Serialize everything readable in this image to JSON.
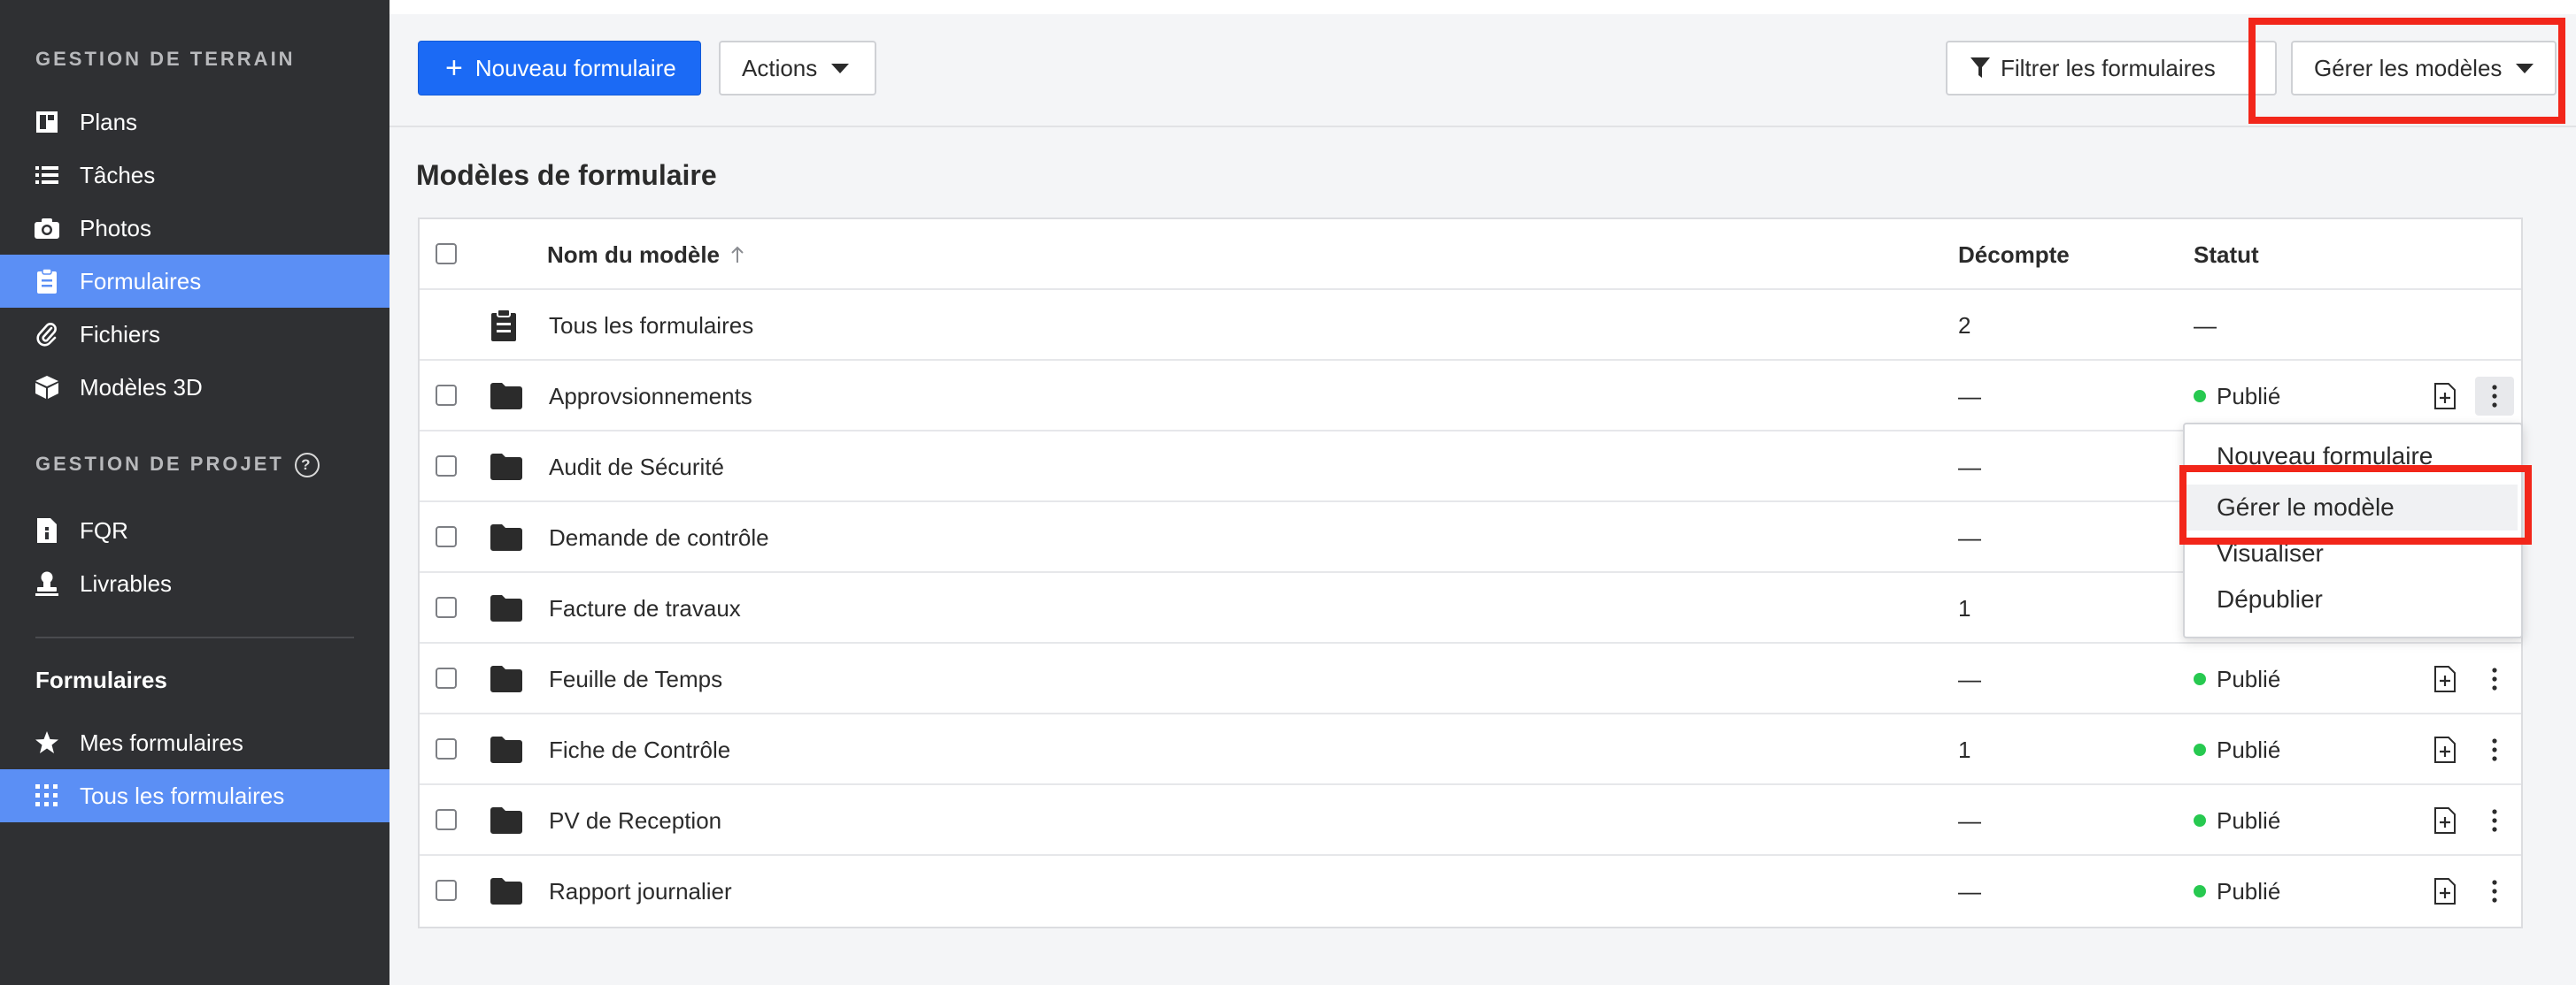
{
  "sidebar": {
    "section_terrain": "GESTION DE TERRAIN",
    "section_projet": "GESTION DE PROJET",
    "terrain_items": [
      {
        "label": "Plans",
        "icon": "plans-icon"
      },
      {
        "label": "Tâches",
        "icon": "list-icon"
      },
      {
        "label": "Photos",
        "icon": "camera-icon"
      },
      {
        "label": "Formulaires",
        "icon": "clipboard-icon"
      },
      {
        "label": "Fichiers",
        "icon": "paperclip-icon"
      },
      {
        "label": "Modèles 3D",
        "icon": "cube-icon"
      }
    ],
    "projet_items": [
      {
        "label": "FQR",
        "icon": "document-info-icon"
      },
      {
        "label": "Livrables",
        "icon": "stamp-icon"
      }
    ],
    "forms_heading": "Formulaires",
    "forms_items": [
      {
        "label": "Mes formulaires",
        "icon": "star-icon"
      },
      {
        "label": "Tous les formulaires",
        "icon": "grid-icon"
      }
    ],
    "active_item": "Formulaires",
    "active_sub_item": "Tous les formulaires"
  },
  "toolbar": {
    "new_form_label": "Nouveau formulaire",
    "actions_label": "Actions",
    "filter_label": "Filtrer les formulaires",
    "manage_templates_label": "Gérer les modèles"
  },
  "page_title": "Modèles de formulaire",
  "table": {
    "columns": {
      "name": "Nom du modèle",
      "count": "Décompte",
      "status": "Statut"
    },
    "rows": [
      {
        "name": "Tous les formulaires",
        "count": "2",
        "status": "—",
        "type": "all",
        "checkbox": false
      },
      {
        "name": "Approvsionnements",
        "count": "—",
        "status": "Publié",
        "type": "folder",
        "checkbox": true
      },
      {
        "name": "Audit de Sécurité",
        "count": "—",
        "status": "",
        "type": "folder",
        "checkbox": true
      },
      {
        "name": "Demande de contrôle",
        "count": "—",
        "status": "",
        "type": "folder",
        "checkbox": true
      },
      {
        "name": "Facture de travaux",
        "count": "1",
        "status": "",
        "type": "folder",
        "checkbox": true
      },
      {
        "name": "Feuille de Temps",
        "count": "—",
        "status": "Publié",
        "type": "folder",
        "checkbox": true
      },
      {
        "name": "Fiche de Contrôle",
        "count": "1",
        "status": "Publié",
        "type": "folder",
        "checkbox": true
      },
      {
        "name": "PV de Reception",
        "count": "—",
        "status": "Publié",
        "type": "folder",
        "checkbox": true
      },
      {
        "name": "Rapport journalier",
        "count": "—",
        "status": "Publié",
        "type": "folder",
        "checkbox": true
      }
    ]
  },
  "context_menu": {
    "items": [
      "Nouveau formulaire",
      "Gérer le modèle",
      "Visualiser",
      "Dépublier"
    ],
    "hovered": "Gérer le modèle"
  },
  "colors": {
    "sidebar_bg": "#2f3033",
    "active": "#5b8ff5",
    "primary": "#1b6af5",
    "published": "#27c950",
    "highlight": "#f2261a"
  }
}
